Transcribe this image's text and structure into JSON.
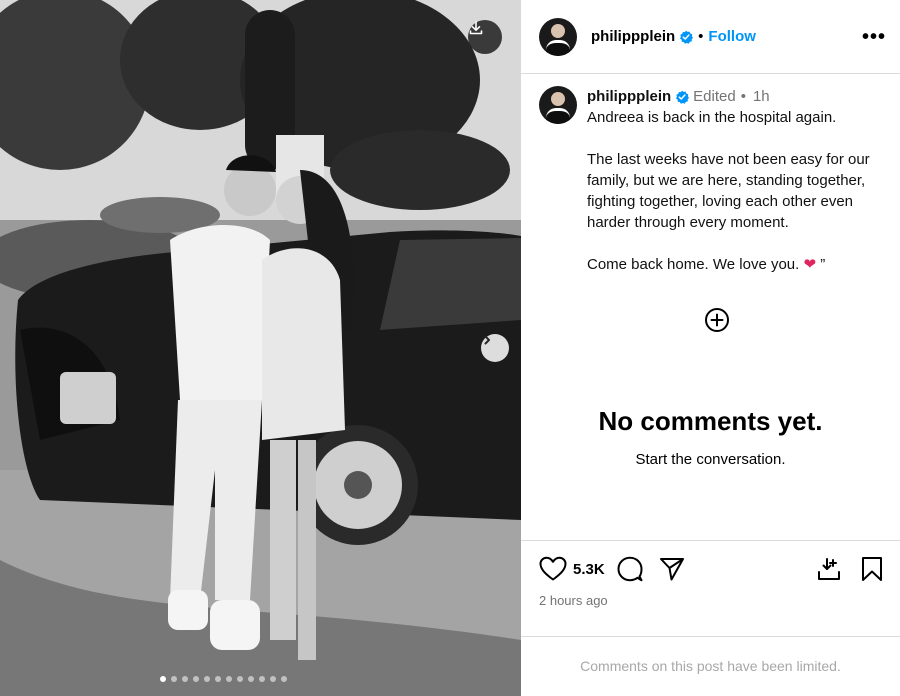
{
  "header": {
    "username": "philippplein",
    "follow_label": "Follow",
    "separator": "•",
    "more_label": "•••"
  },
  "caption": {
    "username": "philippplein",
    "edited_label": "Edited",
    "separator": "•",
    "time": "1h",
    "lines": [
      "Andreea is back in the hospital again.",
      "",
      "The last weeks have not been easy for our family, but we are here, standing together, fighting together, loving each other even harder through every moment.",
      "",
      "Come back home. We love you. ❤️ ”"
    ],
    "line1": "Andreea is back in the hospital again.",
    "line2": "The last weeks have not been easy for our family, but we are here, standing together, fighting together, loving each other even harder through every moment.",
    "line3_text": "Come back home. We love you.",
    "line3_emoji": "❤",
    "line3_tail": " ”"
  },
  "comments": {
    "empty_title": "No comments yet.",
    "empty_subtitle": "Start the conversation."
  },
  "actions": {
    "likes_count": "5.3K",
    "posted_ago": "2 hours ago",
    "limited_notice": "Comments on this post have been limited."
  },
  "icons": {
    "download": "download-icon",
    "next": "chevron-right-icon",
    "verified": "verified-badge-icon",
    "add_comment": "plus-circle-icon",
    "like": "heart-icon",
    "comment": "comment-icon",
    "share": "send-icon",
    "save_to_collection": "download-to-collection-icon",
    "bookmark": "bookmark-icon"
  },
  "colors": {
    "follow_blue": "#0095f6",
    "verified_blue": "#0095f6",
    "muted_text": "#737373",
    "limited_text": "#a8a8a8",
    "heart_red": "#e0245e"
  },
  "carousel": {
    "slide_count": 12,
    "active_index": 0
  }
}
